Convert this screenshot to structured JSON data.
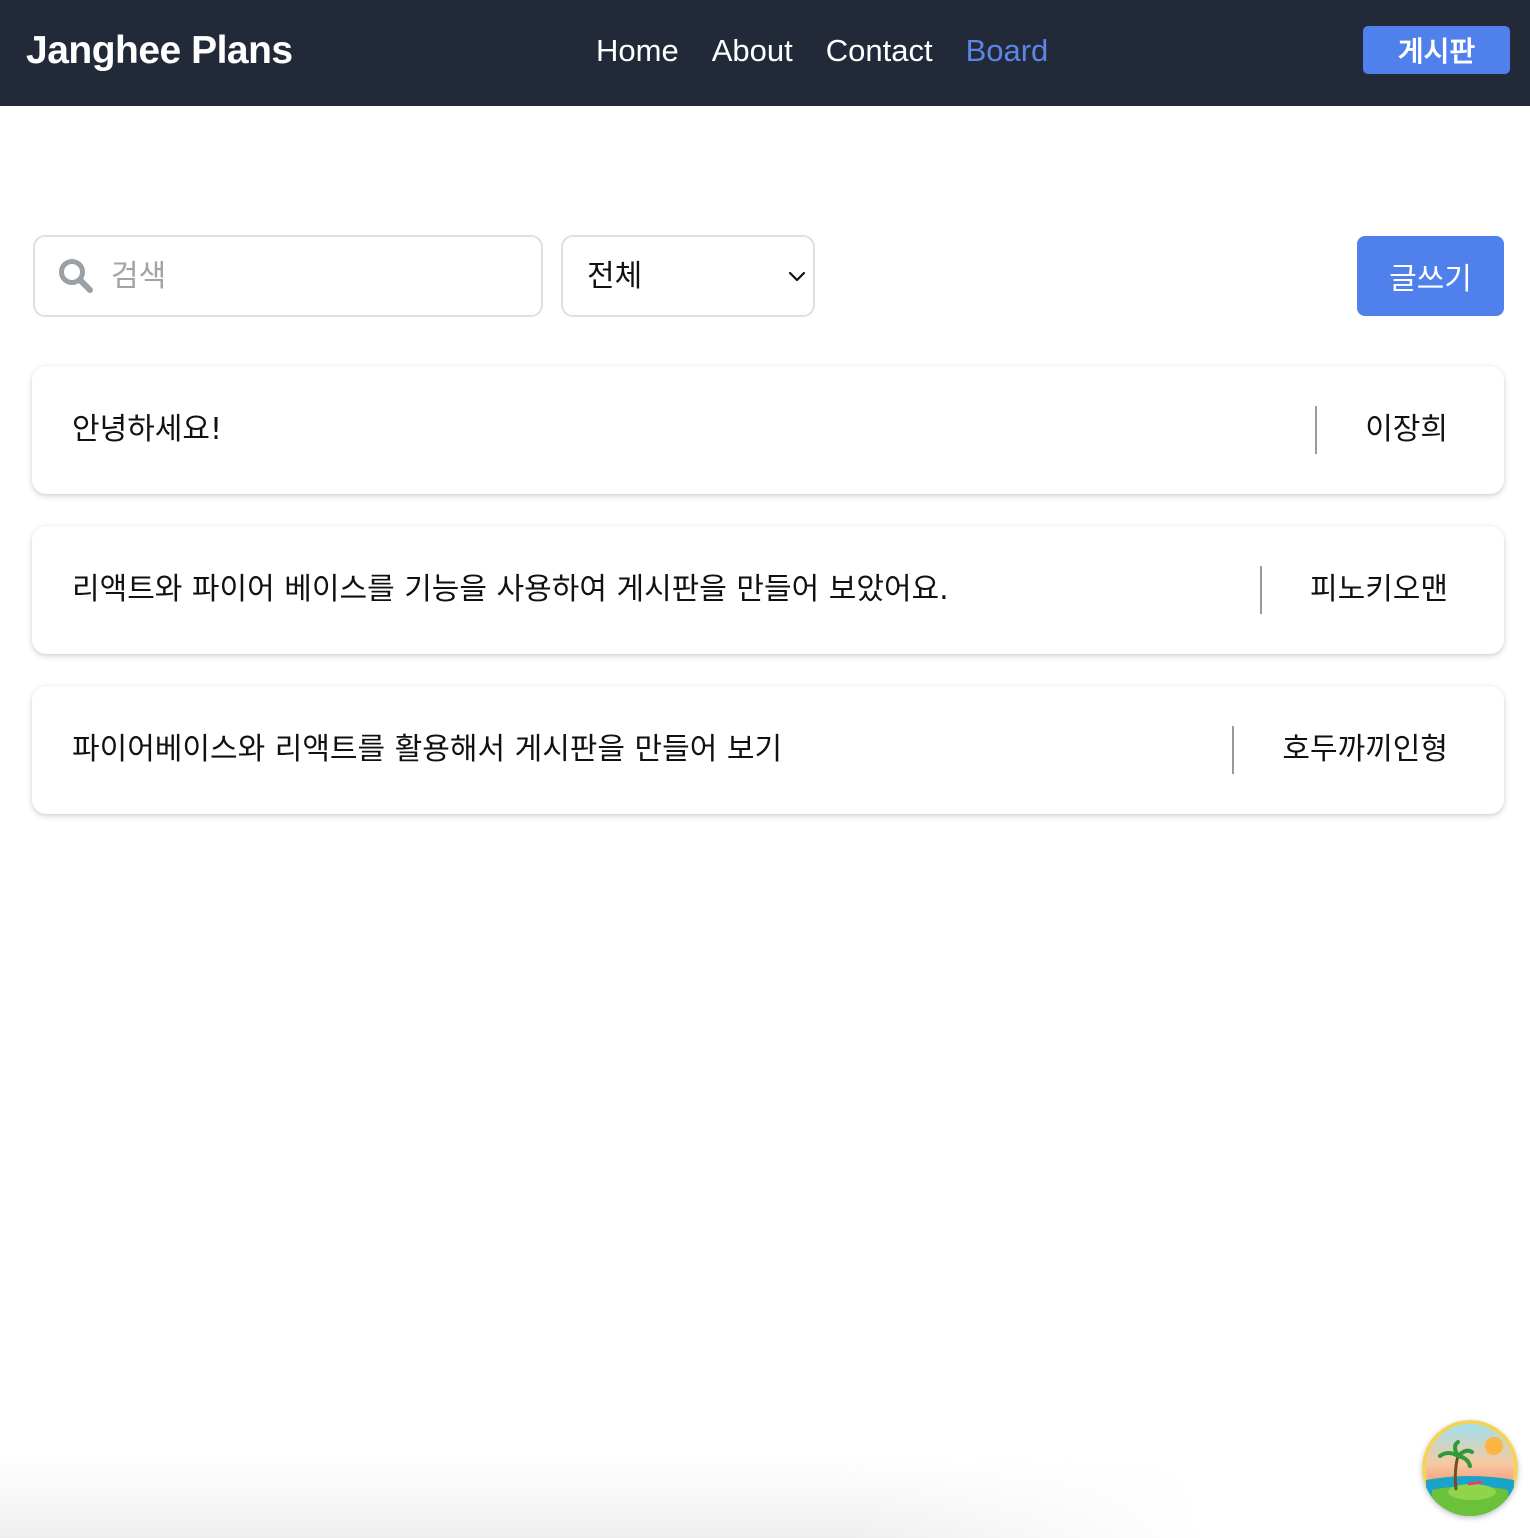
{
  "header": {
    "brand": "Janghee Plans",
    "nav": [
      {
        "label": "Home"
      },
      {
        "label": "About"
      },
      {
        "label": "Contact"
      },
      {
        "label": "Board"
      }
    ],
    "cta_label": "게시판",
    "active_color": "#5b86e5",
    "background": "#222938"
  },
  "toolbar": {
    "search_placeholder": "검색",
    "search_value": "",
    "filter_selected": "전체",
    "write_label": "글쓰기",
    "accent_color": "#4f80ec"
  },
  "posts": [
    {
      "title": "안녕하세요!",
      "author": "이장희"
    },
    {
      "title": "리액트와 파이어 베이스를 기능을 사용하여 게시판을 만들어 보았어요.",
      "author": "피노키오맨"
    },
    {
      "title": "파이어베이스와 리액트를 활용해서 게시판을 만들어 보기",
      "author": "호두까끼인형"
    }
  ],
  "icons": {
    "search": "search-icon",
    "filter": "chevron-down-icon",
    "fab": "beach-avatar-icon"
  }
}
